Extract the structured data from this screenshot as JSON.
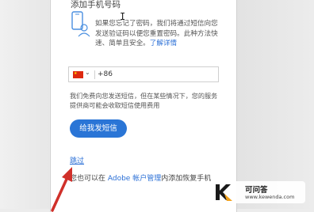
{
  "page": {
    "title": "添加手机号码",
    "description": "如果您忘记了密码，我们将通过短信向您发送验证码以便您重置密码。此种方法快速、简单且安全。",
    "learn_more": "了解详情",
    "country_code": "+86",
    "note": "我们免费向您发送短信，但在某些情况下，您的服务提供商可能会收取短信使用费用",
    "send_button": "给我发短信",
    "skip_link": "跳过",
    "bottom_prefix": "您也可以在 ",
    "bottom_link": "Adobe 帐户管理",
    "bottom_suffix": "内添加恢复手机"
  },
  "watermark": {
    "title": "可问答",
    "url": "www.kewenda.com"
  },
  "colors": {
    "accent": "#2a75d6",
    "arrow": "#d0302a"
  }
}
